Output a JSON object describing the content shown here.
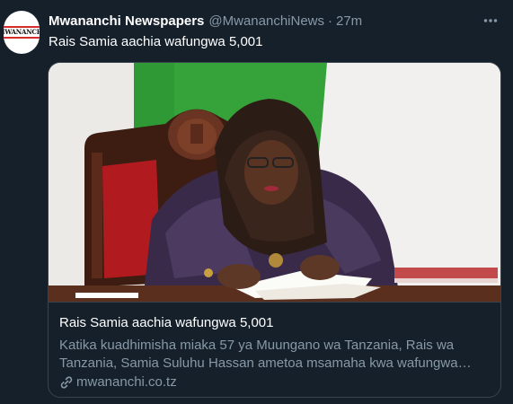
{
  "tweet": {
    "author_name": "Mwananchi Newspapers",
    "handle": "@MwananchiNews",
    "separator": "·",
    "time": "27m",
    "text": "Rais Samia aachia wafungwa 5,001",
    "avatar_text": "MWANANCHI"
  },
  "card": {
    "title": "Rais Samia aachia wafungwa 5,001",
    "description": "Katika kuadhimisha miaka 57 ya Muungano wa Tanzania, Rais wa Tanzania, Samia Suluhu Hassan ametoa msamaha kwa wafungwa 5,001 ...",
    "domain": "mwananchi.co.tz",
    "link_icon": "link-icon"
  },
  "colors": {
    "background": "#15202b",
    "border": "#38444d",
    "secondary_text": "#8899a6"
  }
}
